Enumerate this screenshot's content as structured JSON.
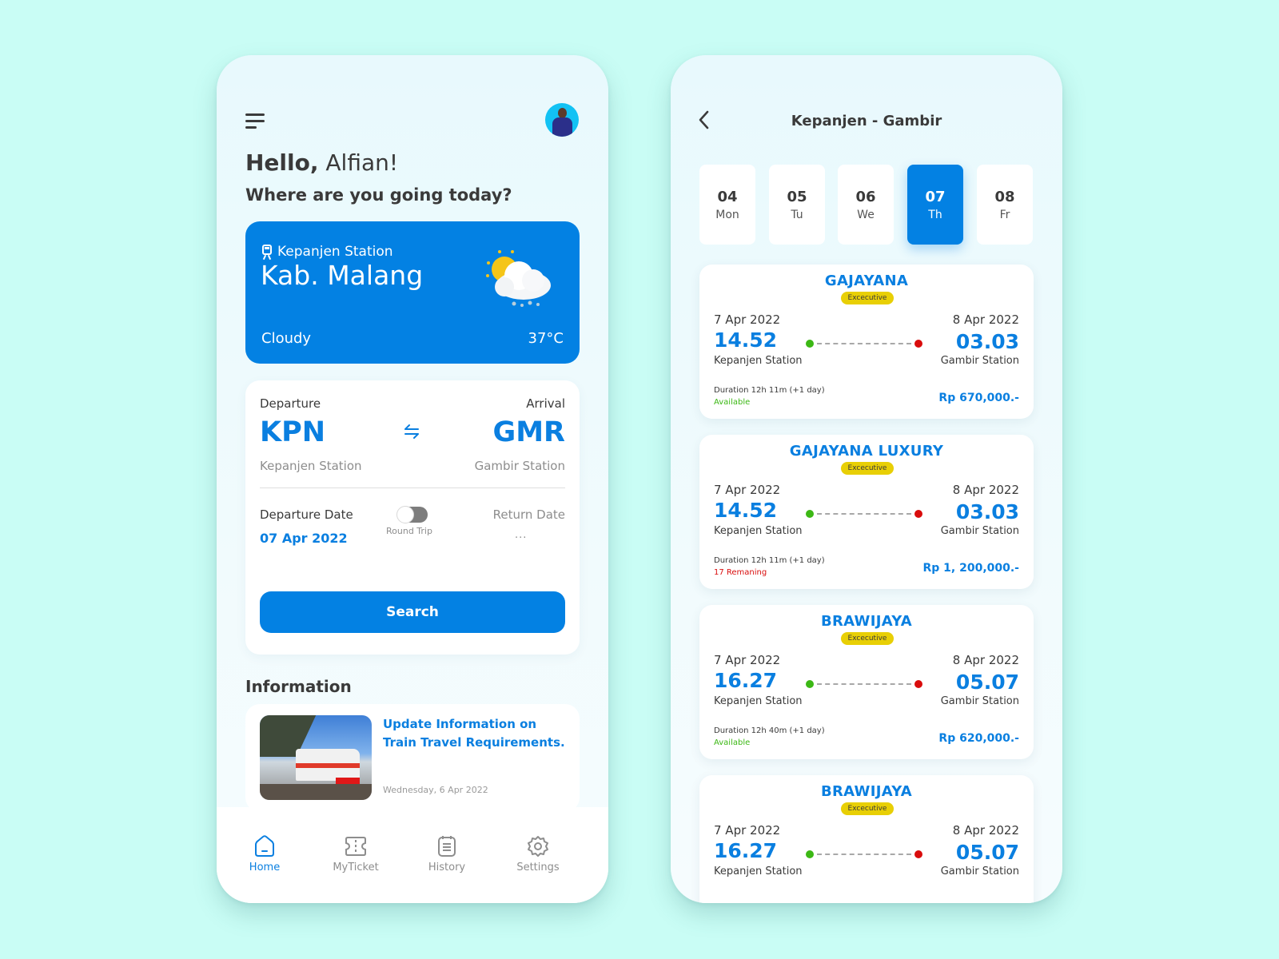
{
  "colors": {
    "background": "#c9fdf5",
    "accent": "#0381e3",
    "class_badge": "#e8cf05",
    "available": "#3cb815",
    "remaining": "#d90c0c"
  },
  "home": {
    "menu_icon": "hamburger-menu-icon",
    "avatar_icon": "user-avatar",
    "greeting_prefix": "Hello,",
    "greeting_name": " Alfian!",
    "subtitle": "Where are you going today?",
    "weather": {
      "station_icon": "train-icon",
      "station": "Kepanjen Station",
      "city": "Kab. Malang",
      "condition_icon": "partly-cloudy-icon",
      "condition": "Cloudy",
      "temperature": "37°C"
    },
    "search": {
      "departure_label": "Departure",
      "arrival_label": "Arrival",
      "departure_code": "KPN",
      "arrival_code": "GMR",
      "departure_station": "Kepanjen Station",
      "arrival_station": "Gambir Station",
      "swap_icon": "swap-arrows-icon",
      "departure_date_label": "Departure Date",
      "departure_date": "07 Apr 2022",
      "round_trip_label": "Round Trip",
      "round_trip_enabled": false,
      "return_date_label": "Return Date",
      "return_date": "...",
      "search_button": "Search"
    },
    "information": {
      "title": "Information",
      "items": [
        {
          "title": "Update Information on Train Travel Requirements.",
          "date": "Wednesday, 6 Apr 2022"
        }
      ]
    },
    "nav": [
      {
        "label": "Home",
        "icon": "home-icon",
        "active": true
      },
      {
        "label": "MyTicket",
        "icon": "ticket-icon",
        "active": false
      },
      {
        "label": "History",
        "icon": "history-icon",
        "active": false
      },
      {
        "label": "Settings",
        "icon": "settings-icon",
        "active": false
      }
    ]
  },
  "results": {
    "back_icon": "chevron-left-icon",
    "title": "Kepanjen - Gambir",
    "dates": [
      {
        "day": "04",
        "weekday": "Mon",
        "selected": false
      },
      {
        "day": "05",
        "weekday": "Tu",
        "selected": false
      },
      {
        "day": "06",
        "weekday": "We",
        "selected": false
      },
      {
        "day": "07",
        "weekday": "Th",
        "selected": true
      },
      {
        "day": "08",
        "weekday": "Fr",
        "selected": false
      }
    ],
    "trips": [
      {
        "name": "GAJAYANA",
        "class": "Excecutive",
        "dep_date": "7 Apr 2022",
        "arr_date": "8 Apr 2022",
        "dep_time": "14.52",
        "arr_time": "03.03",
        "dep_station": "Kepanjen Station",
        "arr_station": "Gambir Station",
        "duration": "Duration 12h 11m (+1 day)",
        "availability": "Available",
        "availability_status": "available",
        "price": "Rp 670,000.-"
      },
      {
        "name": "GAJAYANA LUXURY",
        "class": "Excecutive",
        "dep_date": "7 Apr 2022",
        "arr_date": "8 Apr 2022",
        "dep_time": "14.52",
        "arr_time": "03.03",
        "dep_station": "Kepanjen Station",
        "arr_station": "Gambir Station",
        "duration": "Duration 12h 11m (+1 day)",
        "availability": "17 Remaning",
        "availability_status": "remaining",
        "price": "Rp 1, 200,000.-"
      },
      {
        "name": "BRAWIJAYA",
        "class": "Excecutive",
        "dep_date": "7 Apr 2022",
        "arr_date": "8 Apr 2022",
        "dep_time": "16.27",
        "arr_time": "05.07",
        "dep_station": "Kepanjen Station",
        "arr_station": "Gambir Station",
        "duration": "Duration 12h 40m (+1 day)",
        "availability": "Available",
        "availability_status": "available",
        "price": "Rp 620,000.-"
      },
      {
        "name": "BRAWIJAYA",
        "class": "Excecutive",
        "dep_date": "7 Apr 2022",
        "arr_date": "8 Apr 2022",
        "dep_time": "16.27",
        "arr_time": "05.07",
        "dep_station": "Kepanjen Station",
        "arr_station": "Gambir Station"
      }
    ]
  }
}
